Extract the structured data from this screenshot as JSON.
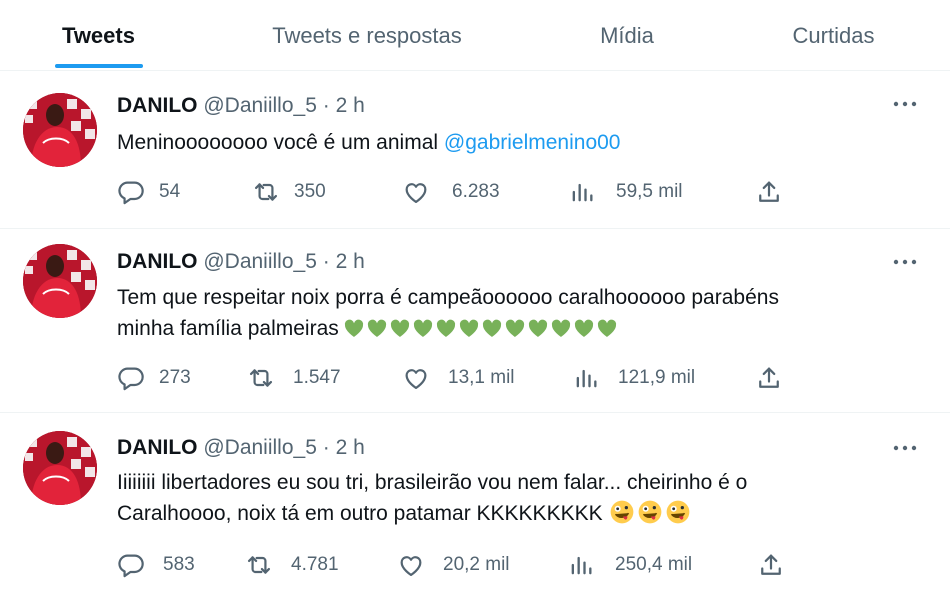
{
  "tabs": [
    {
      "label": "Tweets",
      "active": true
    },
    {
      "label": "Tweets e respostas",
      "active": false
    },
    {
      "label": "Mídia",
      "active": false
    },
    {
      "label": "Curtidas",
      "active": false
    }
  ],
  "colors": {
    "accent": "#1d9bf0",
    "heart_emoji": "#78b159",
    "text": "#0f1419",
    "muted": "#536471"
  },
  "tweets": [
    {
      "name": "DANILO",
      "handle": "@Daniillo_5",
      "sep": "·",
      "time": "2 h",
      "text_line1": "Meninoooooooo você é um animal",
      "mention": "@gabrielmenino00",
      "replies": "54",
      "retweets": "350",
      "likes": "6.283",
      "views": "59,5 mil"
    },
    {
      "name": "DANILO",
      "handle": "@Daniillo_5",
      "sep": "·",
      "time": "2 h",
      "text_line1": "Tem que respeitar noix porra é campeãoooooo caralhoooooo parabéns",
      "text_line2": "minha família palmeiras",
      "emoji": "green-heart",
      "emoji_count": 12,
      "replies": "273",
      "retweets": "1.547",
      "likes": "13,1 mil",
      "views": "121,9 mil"
    },
    {
      "name": "DANILO",
      "handle": "@Daniillo_5",
      "sep": "·",
      "time": "2 h",
      "text_line1": "Iiiiiiii libertadores eu sou tri, brasileirão vou nem falar... cheirinho é o",
      "text_line2": "Caralhoooo, noix tá em outro patamar KKKKKKKKK",
      "emoji": "zany-face",
      "emoji_count": 3,
      "replies": "583",
      "retweets": "4.781",
      "likes": "20,2 mil",
      "views": "250,4 mil"
    }
  ]
}
